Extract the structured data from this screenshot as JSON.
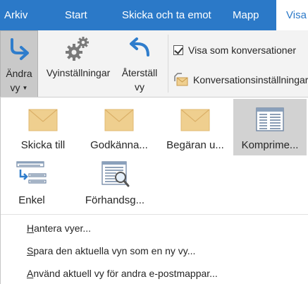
{
  "tabs": [
    {
      "label": "Arkiv",
      "active": false
    },
    {
      "label": "Start",
      "active": false
    },
    {
      "label": "Skicka och ta emot",
      "active": false
    },
    {
      "label": "Mapp",
      "active": false
    },
    {
      "label": "Visa",
      "active": true
    }
  ],
  "ribbon": {
    "change_view": {
      "line1": "Ändra",
      "line2": "vy",
      "icon": "change-view-arrow-icon"
    },
    "view_settings": {
      "label": "Vyinställningar",
      "icon": "gears-icon"
    },
    "reset_view": {
      "line1": "Återställ",
      "line2": "vy",
      "icon": "reset-arrow-icon"
    },
    "show_as_conversations": {
      "label": "Visa som konversationer",
      "checked": true
    },
    "conversation_settings": {
      "label": "Konversationsinställningar",
      "icon": "conversation-settings-icon"
    }
  },
  "gallery": [
    {
      "label": "Skicka till",
      "icon": "envelope-icon",
      "selected": false
    },
    {
      "label": "Godkänna...",
      "icon": "envelope-icon",
      "selected": false
    },
    {
      "label": "Begäran u...",
      "icon": "envelope-icon",
      "selected": false
    },
    {
      "label": "Komprime...",
      "icon": "compact-view-icon",
      "selected": true
    },
    {
      "label": "Enkel",
      "icon": "simple-view-icon",
      "selected": false
    },
    {
      "label": "Förhandsg...",
      "icon": "preview-view-icon",
      "selected": false
    }
  ],
  "menu": {
    "manage_views": {
      "key": "H",
      "rest": "antera vyer..."
    },
    "save_view": {
      "key": "S",
      "rest": "para den aktuella vyn som en ny vy..."
    },
    "apply_view": {
      "key": "A",
      "rest": "nvänd aktuell vy för andra e-postmappar..."
    }
  },
  "colors": {
    "tab_bar": "#2b79c8",
    "ribbon_bg": "#f3f3f3",
    "selected_item": "#d2d2d2",
    "envelope": "#efcf8f"
  }
}
